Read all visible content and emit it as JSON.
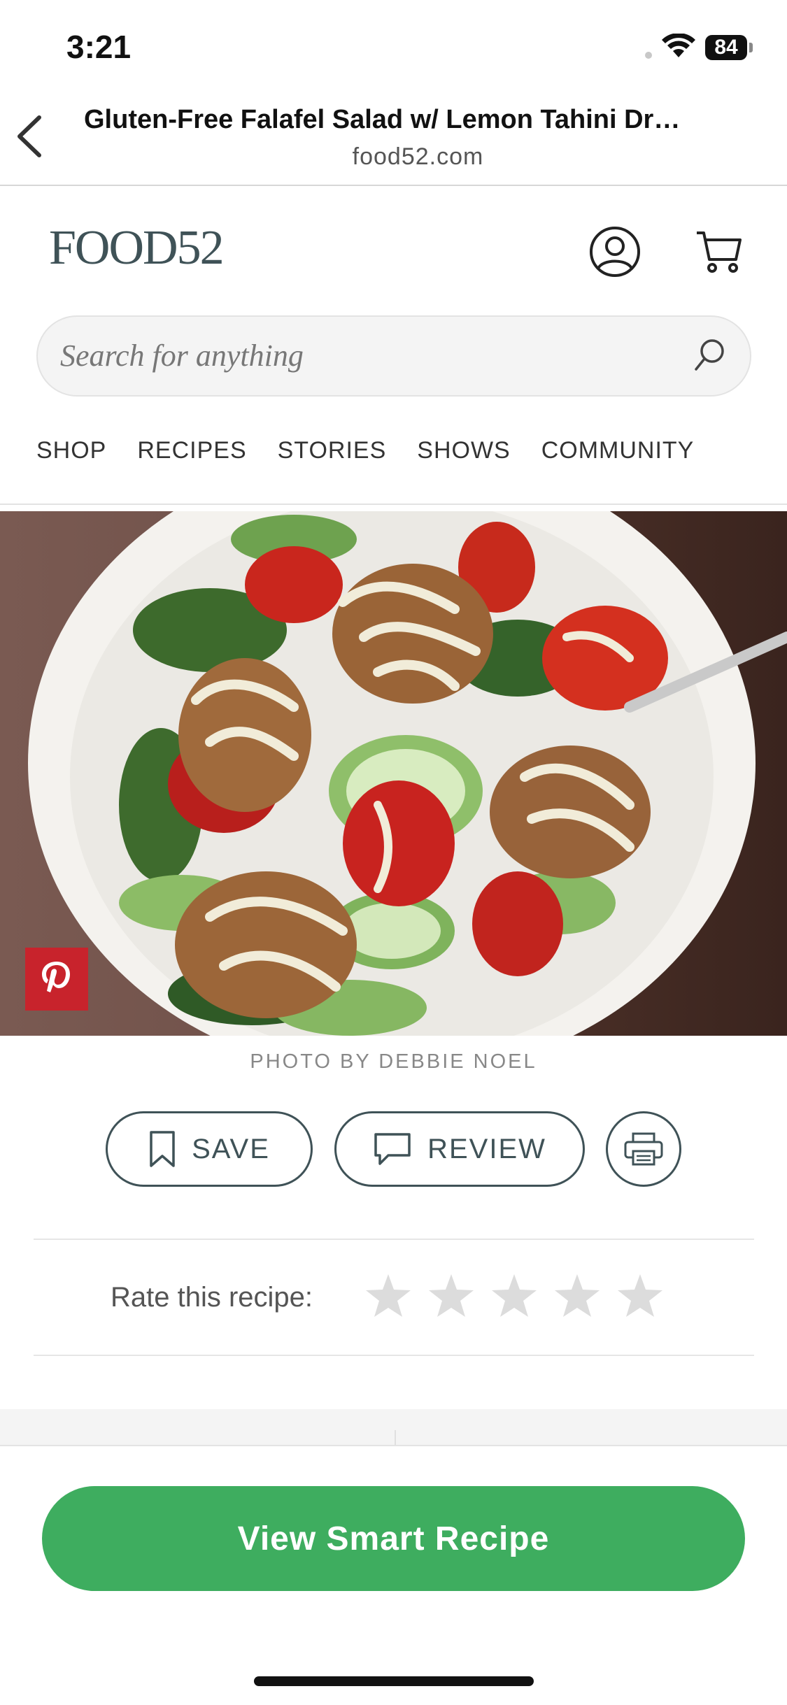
{
  "status": {
    "time": "3:21",
    "battery": "84"
  },
  "browser": {
    "title": "Gluten-Free Falafel Salad w/ Lemon Tahini Dr…",
    "domain": "food52.com"
  },
  "site": {
    "logo": "FOOD52",
    "search_placeholder": "Search for anything",
    "nav": [
      "SHOP",
      "RECIPES",
      "STORIES",
      "SHOWS",
      "COMMUNITY"
    ]
  },
  "photo": {
    "credit": "PHOTO BY DEBBIE NOEL"
  },
  "actions": {
    "save": "SAVE",
    "review": "REVIEW"
  },
  "rating": {
    "label": "Rate this recipe:",
    "value": 0,
    "max": 5
  },
  "cta": {
    "label": "View Smart Recipe"
  },
  "colors": {
    "brand": "#3f5257",
    "cta": "#3ead5f",
    "pinterest": "#c8232c"
  }
}
